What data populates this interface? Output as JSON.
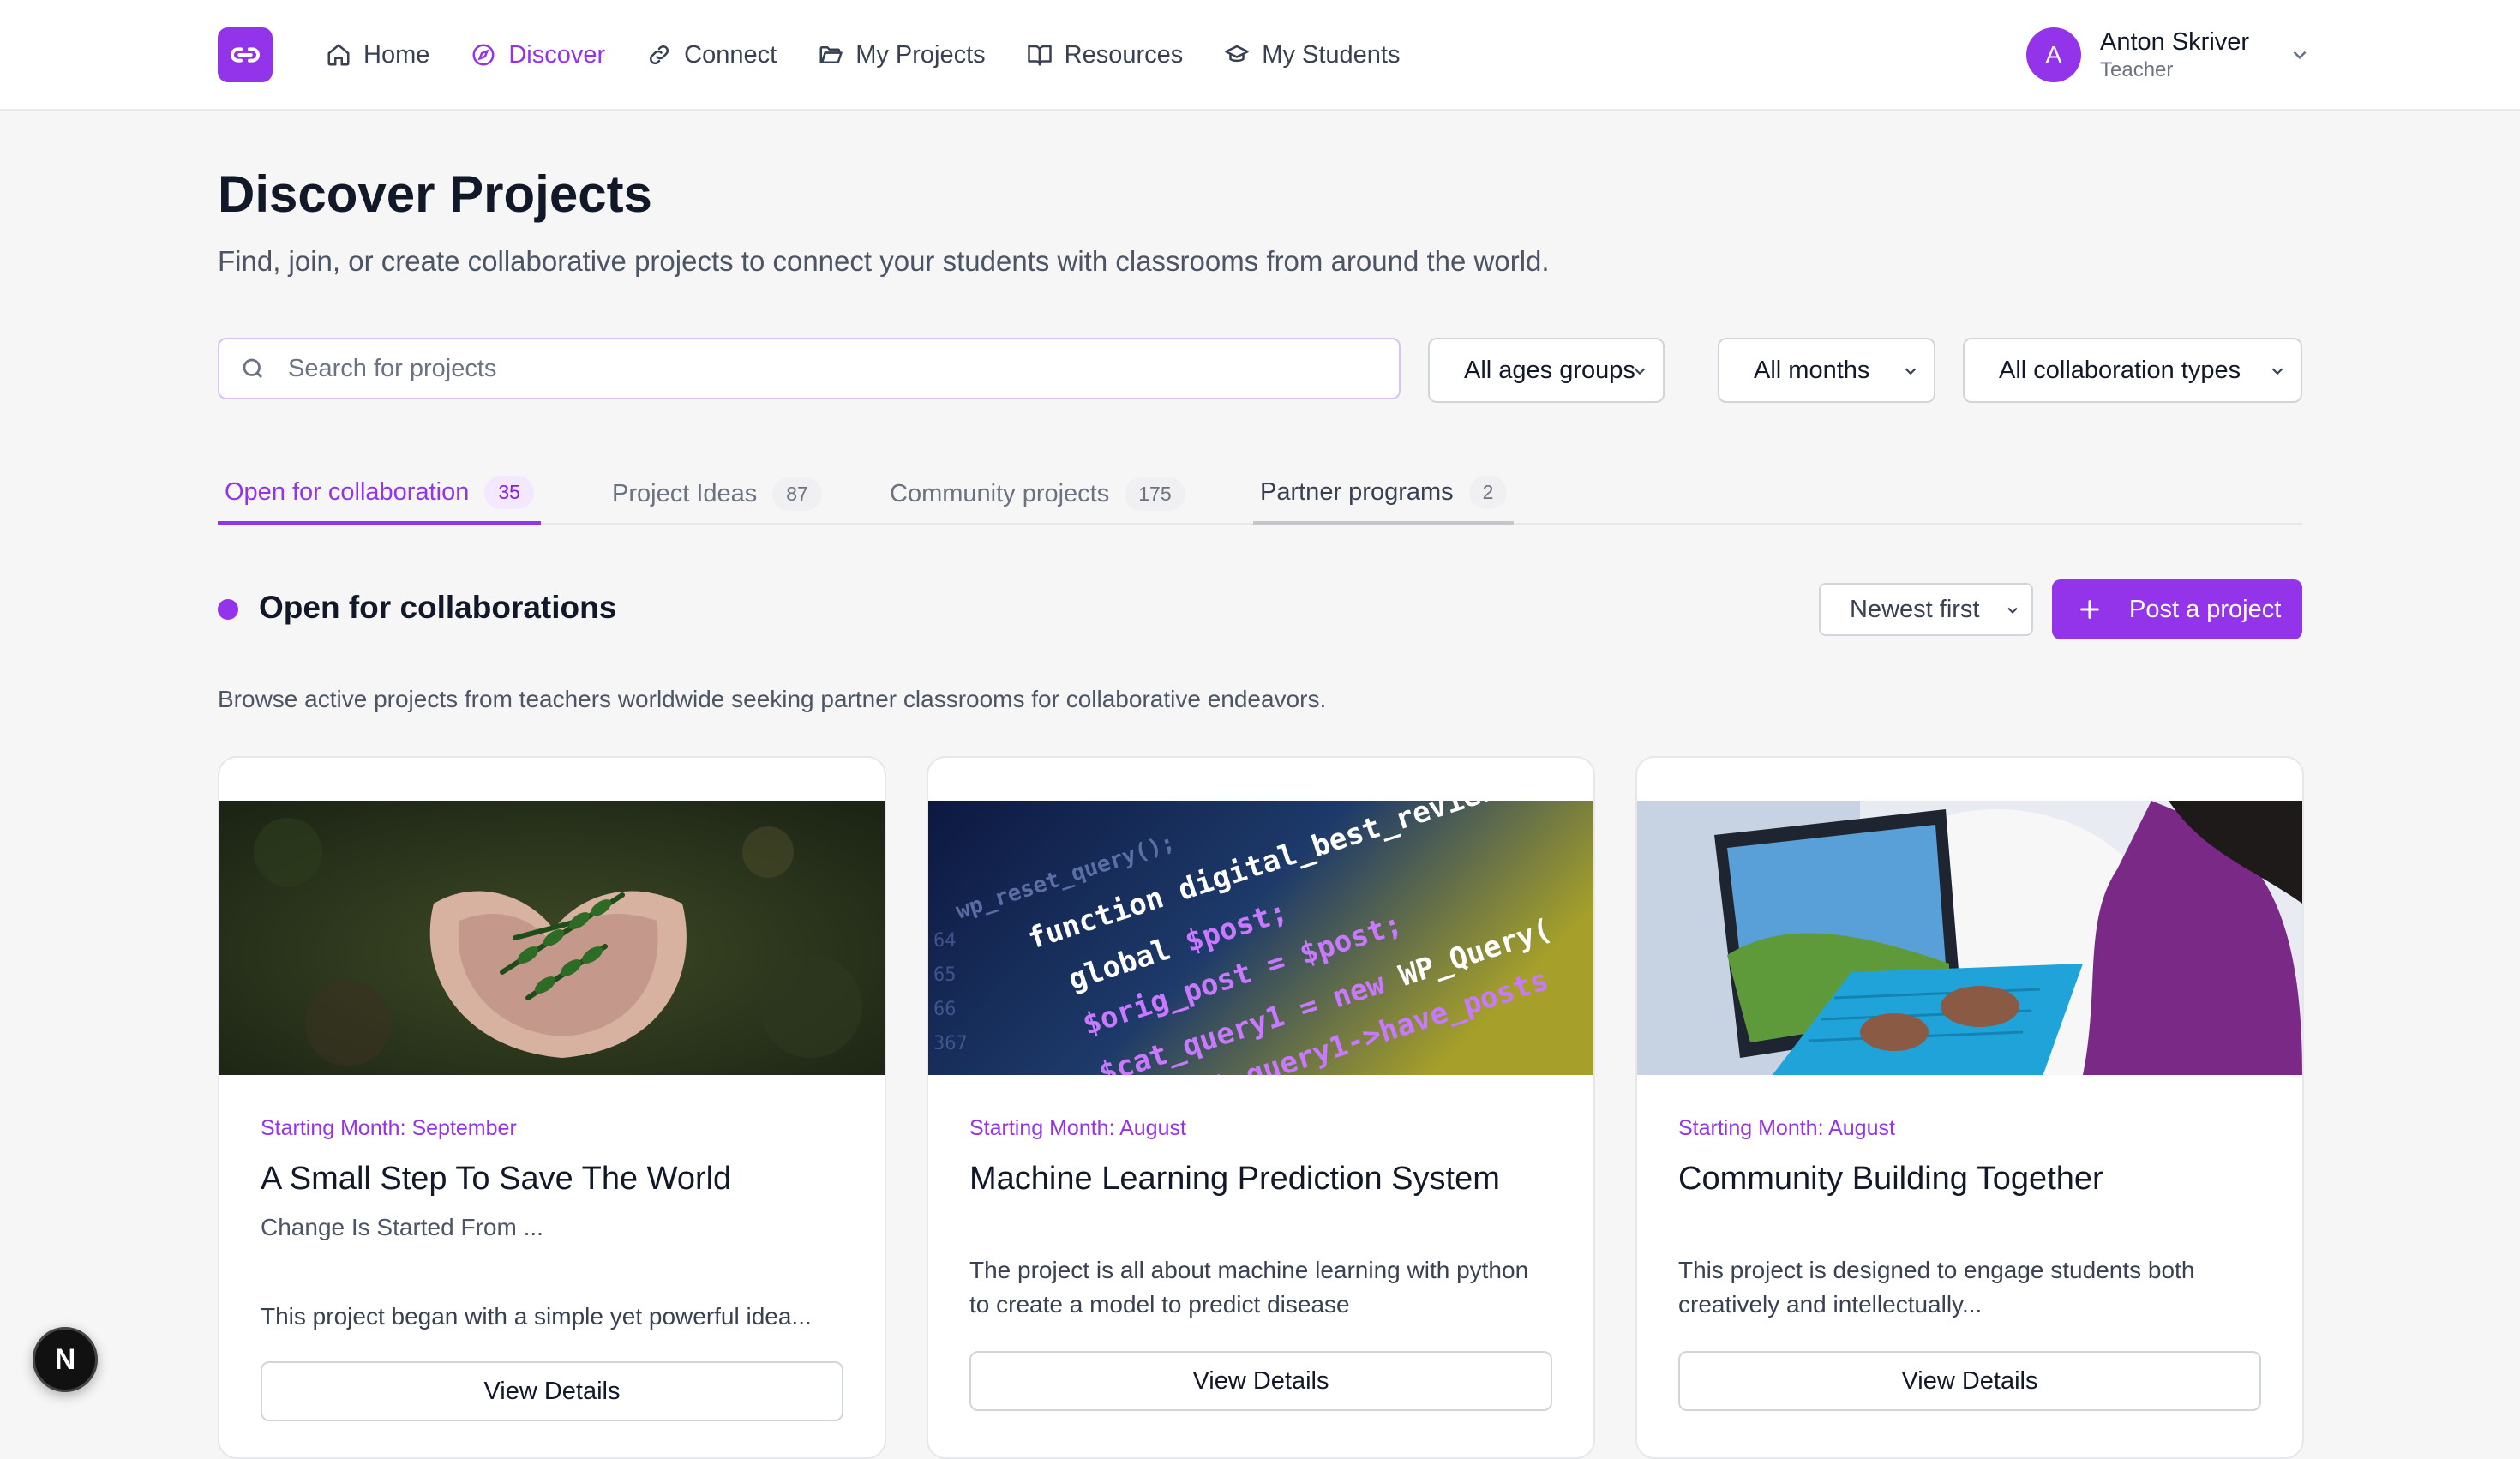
{
  "nav": {
    "items": [
      {
        "label": "Home",
        "icon": "home-icon"
      },
      {
        "label": "Discover",
        "icon": "compass-icon",
        "active": true
      },
      {
        "label": "Connect",
        "icon": "link-icon"
      },
      {
        "label": "My Projects",
        "icon": "folder-icon"
      },
      {
        "label": "Resources",
        "icon": "book-icon"
      },
      {
        "label": "My Students",
        "icon": "graduation-cap-icon"
      }
    ]
  },
  "user": {
    "initial": "A",
    "name": "Anton Skriver",
    "role": "Teacher"
  },
  "page": {
    "title": "Discover Projects",
    "subtitle": "Find, join, or create collaborative projects to connect your students with classrooms from around the world."
  },
  "filters": {
    "search_placeholder": "Search for projects",
    "age": "All ages groups",
    "months": "All months",
    "collab": "All collaboration types"
  },
  "tabs": [
    {
      "label": "Open for collaboration",
      "count": "35"
    },
    {
      "label": "Project Ideas",
      "count": "87"
    },
    {
      "label": "Community projects",
      "count": "175"
    },
    {
      "label": "Partner programs",
      "count": "2"
    }
  ],
  "section": {
    "title": "Open for collaborations",
    "sort": "Newest first",
    "post_label": "Post a project",
    "description": "Browse active projects from teachers worldwide seeking partner classrooms for collaborative endeavors."
  },
  "cards": [
    {
      "month": "Starting Month: September",
      "title": "A Small Step To Save The World",
      "subtitle": "Change Is Started From ...",
      "description": "This project began with a simple yet powerful idea...",
      "button": "View Details"
    },
    {
      "month": "Starting Month: August",
      "title": "Machine Learning Prediction System",
      "subtitle": "",
      "description": "The project is all about machine learning with python to create a model to predict disease",
      "button": "View Details"
    },
    {
      "month": "Starting Month: August",
      "title": "Community Building Together",
      "subtitle": "",
      "description": "This project is designed to engage students both creatively and intellectually...",
      "button": "View Details"
    }
  ],
  "dev_badge": "N",
  "colors": {
    "accent": "#9333ea"
  }
}
